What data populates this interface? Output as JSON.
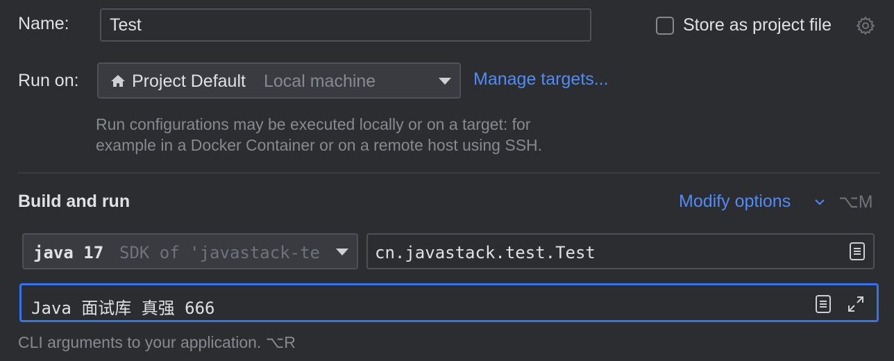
{
  "name": {
    "label": "Name:",
    "value": "Test"
  },
  "store_as_project_file": {
    "label": "Store as project file",
    "checked": false
  },
  "run_on": {
    "label": "Run on:",
    "selected": "Project Default",
    "selected_detail": "Local machine",
    "manage_targets_link": "Manage targets...",
    "hint_line1": "Run configurations may be executed locally or on a target: for",
    "hint_line2": "example in a Docker Container or on a remote host using SSH."
  },
  "build_and_run": {
    "title": "Build and run",
    "modify_options": "Modify options",
    "modify_options_shortcut": "⌥M",
    "jdk_selected": "java 17",
    "jdk_detail": "SDK of 'javastack-te",
    "main_class": "cn.javastack.test.Test",
    "program_arguments": "Java 面试库 真强 666",
    "program_arguments_hint": "CLI arguments to your application. ⌥R"
  },
  "icons": {
    "gear": "gear-icon",
    "home": "home-icon",
    "chevron": "chevron-down-icon",
    "browse": "document-icon",
    "expand": "expand-icon"
  },
  "colors": {
    "background": "#2b2d30",
    "link": "#548af7",
    "focus": "#3574f0",
    "hint": "#868a91",
    "text": "#dfe1e5"
  }
}
